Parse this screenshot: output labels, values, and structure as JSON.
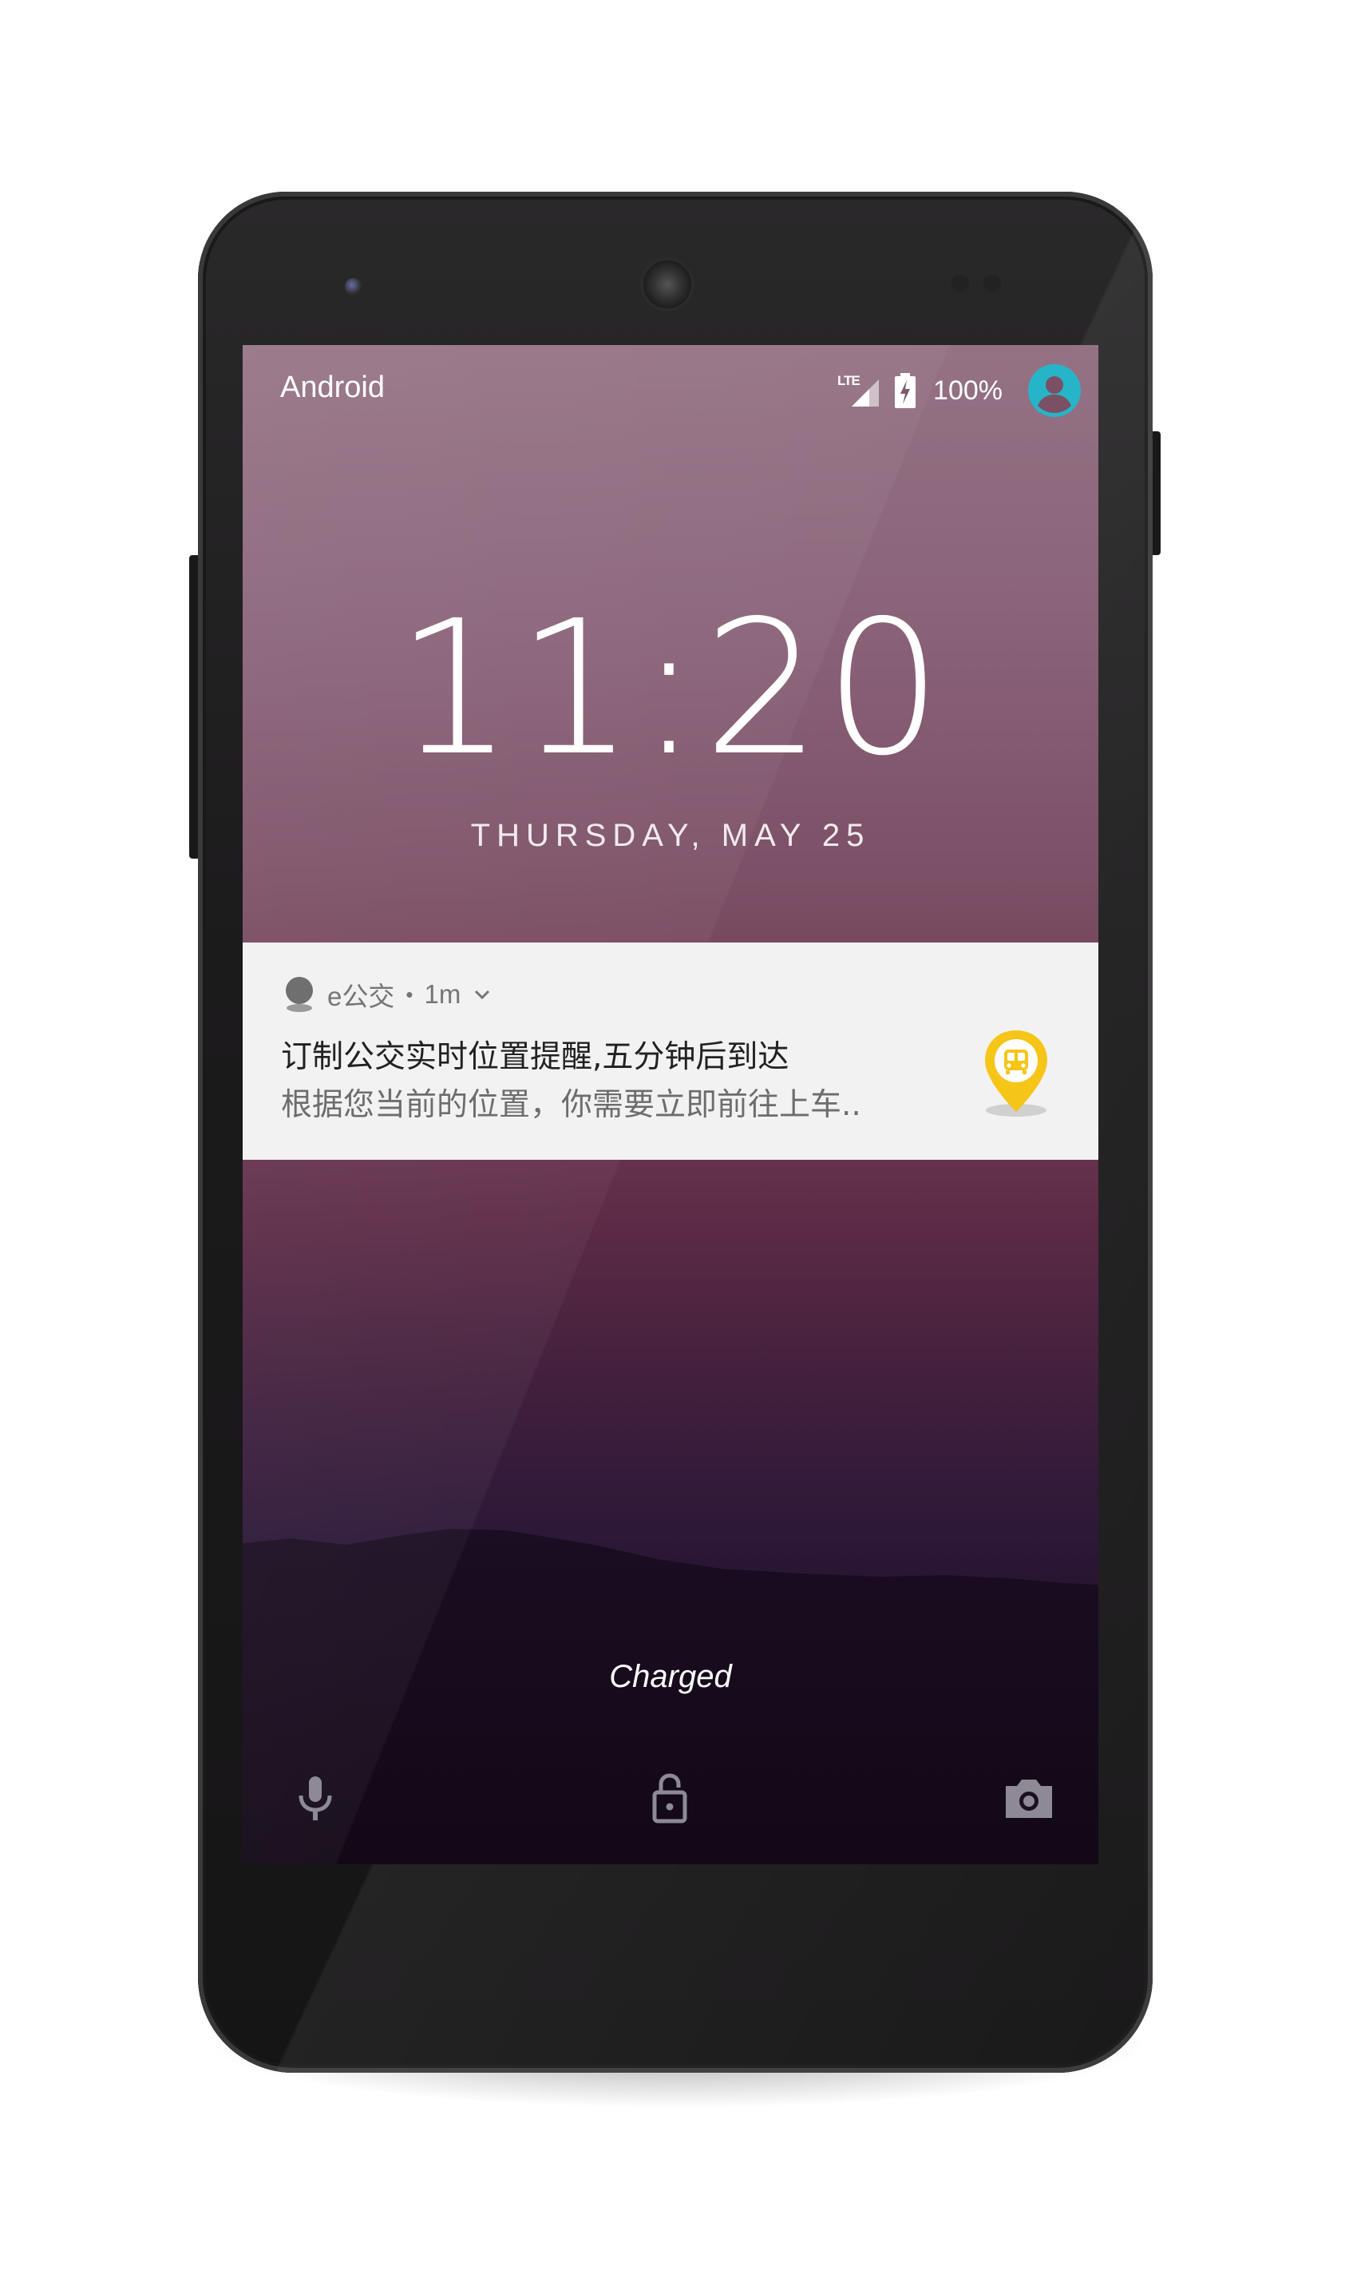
{
  "status_bar": {
    "carrier": "Android",
    "network": "LTE",
    "battery": "100%"
  },
  "lockscreen": {
    "time": "11:20",
    "date": "THURSDAY, MAY 25",
    "charging_status": "Charged"
  },
  "notification": {
    "app_name": "e公交",
    "separator": "•",
    "time_ago": "1m",
    "title": "订制公交实时位置提醒,五分钟后到达",
    "body": "根据您当前的位置，你需要立即前往上车..",
    "large_icon": "bus-location-pin-icon"
  },
  "shortcuts": {
    "left": "mic-icon",
    "center": "unlock-icon",
    "right": "camera-icon"
  },
  "colors": {
    "avatar": "#26b5c8",
    "notification_icon": "#f5c518",
    "notification_bg": "#f3f2f3"
  }
}
